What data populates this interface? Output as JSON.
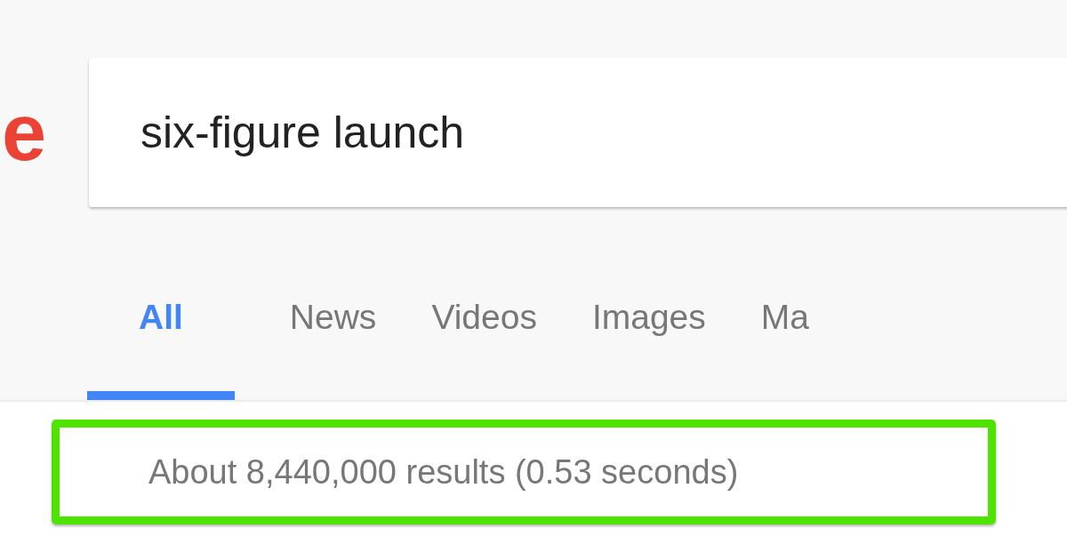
{
  "logo": {
    "text": "e"
  },
  "search": {
    "value": "six-figure launch"
  },
  "tabs": [
    {
      "label": "All",
      "selected": true
    },
    {
      "label": "News",
      "selected": false
    },
    {
      "label": "Videos",
      "selected": false
    },
    {
      "label": "Images",
      "selected": false
    },
    {
      "label": "Ma",
      "selected": false
    }
  ],
  "result_stats": {
    "text": "About 8,440,000 results (0.53 seconds)",
    "highlighted": true
  }
}
